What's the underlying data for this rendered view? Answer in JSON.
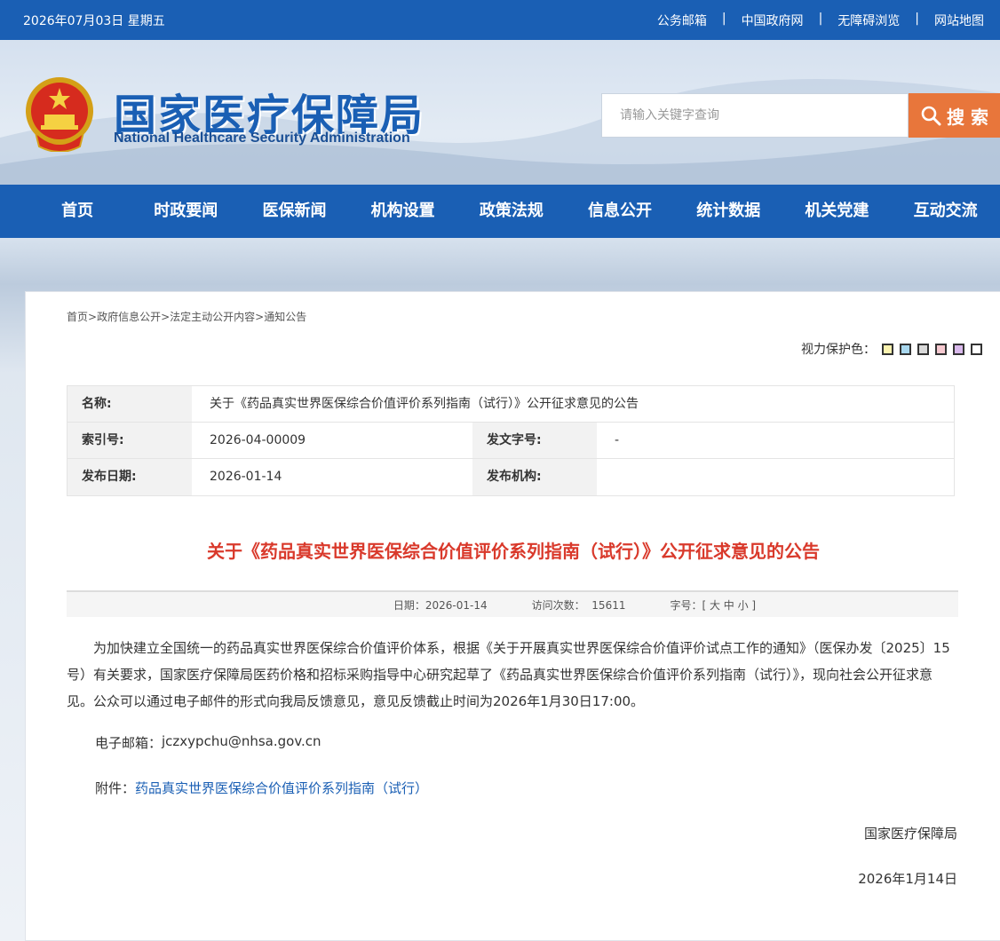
{
  "topbar": {
    "date": "2026年07月03日 星期五",
    "links": [
      "公务邮箱",
      "中国政府网",
      "无障碍浏览",
      "网站地图"
    ],
    "separator": "|"
  },
  "header": {
    "title_cn": "国家医疗保障局",
    "title_en": "National Healthcare Security Administration",
    "search_placeholder": "请输入关键字查询",
    "search_button": "搜 索"
  },
  "nav": [
    "首页",
    "时政要闻",
    "医保新闻",
    "机构设置",
    "政策法规",
    "信息公开",
    "统计数据",
    "机关党建",
    "互动交流"
  ],
  "breadcrumb": [
    "首页>",
    " 政府信息公开>",
    " 法定主动公开内容>",
    " 通知公告"
  ],
  "eyecare": {
    "label": "视力保护色：",
    "colors": [
      "#fbf3b0",
      "#a9d8ef",
      "#d9d9d9",
      "#f6c9d0",
      "#d9b9ec",
      "#ffffff"
    ]
  },
  "meta": {
    "name_label": "名称:",
    "name_value": "关于《药品真实世界医保综合价值评价系列指南（试行）》公开征求意见的公告",
    "index_label": "索引号:",
    "index_value": "2026-04-00009",
    "docno_label": "发文字号:",
    "docno_value": "-",
    "date_label": "发布日期:",
    "date_value": "2026-01-14",
    "org_label": "发布机构:",
    "org_value": ""
  },
  "article": {
    "title": "关于《药品真实世界医保综合价值评价系列指南（试行）》公开征求意见的公告",
    "info_date": "日期：2026-01-14",
    "info_visits_label": "访问次数：",
    "info_visits": "15611",
    "info_font": "字号：[ 大 中 小 ]",
    "paragraph": "为加快建立全国统一的药品真实世界医保综合价值评价体系，根据《关于开展真实世界医保综合价值评价试点工作的通知》（医保办发〔2025〕15号）有关要求，国家医疗保障局医药价格和招标采购指导中心研究起草了《药品真实世界医保综合价值评价系列指南（试行）》，现向社会公开征求意见。公众可以通过电子邮件的形式向我局反馈意见，意见反馈截止时间为2026年1月30日17:00。",
    "email_label": "电子邮箱：",
    "email_value": "jczxypchu@nhsa.gov.cn",
    "attach_label": "附件：",
    "attach_link": "药品真实世界医保综合价值评价系列指南（试行）",
    "signature": "国家医疗保障局",
    "sign_date": "2026年1月14日"
  },
  "colors": {
    "brand_blue": "#1a5fb4",
    "search_orange": "#e8763b",
    "title_red": "#d9392b"
  }
}
